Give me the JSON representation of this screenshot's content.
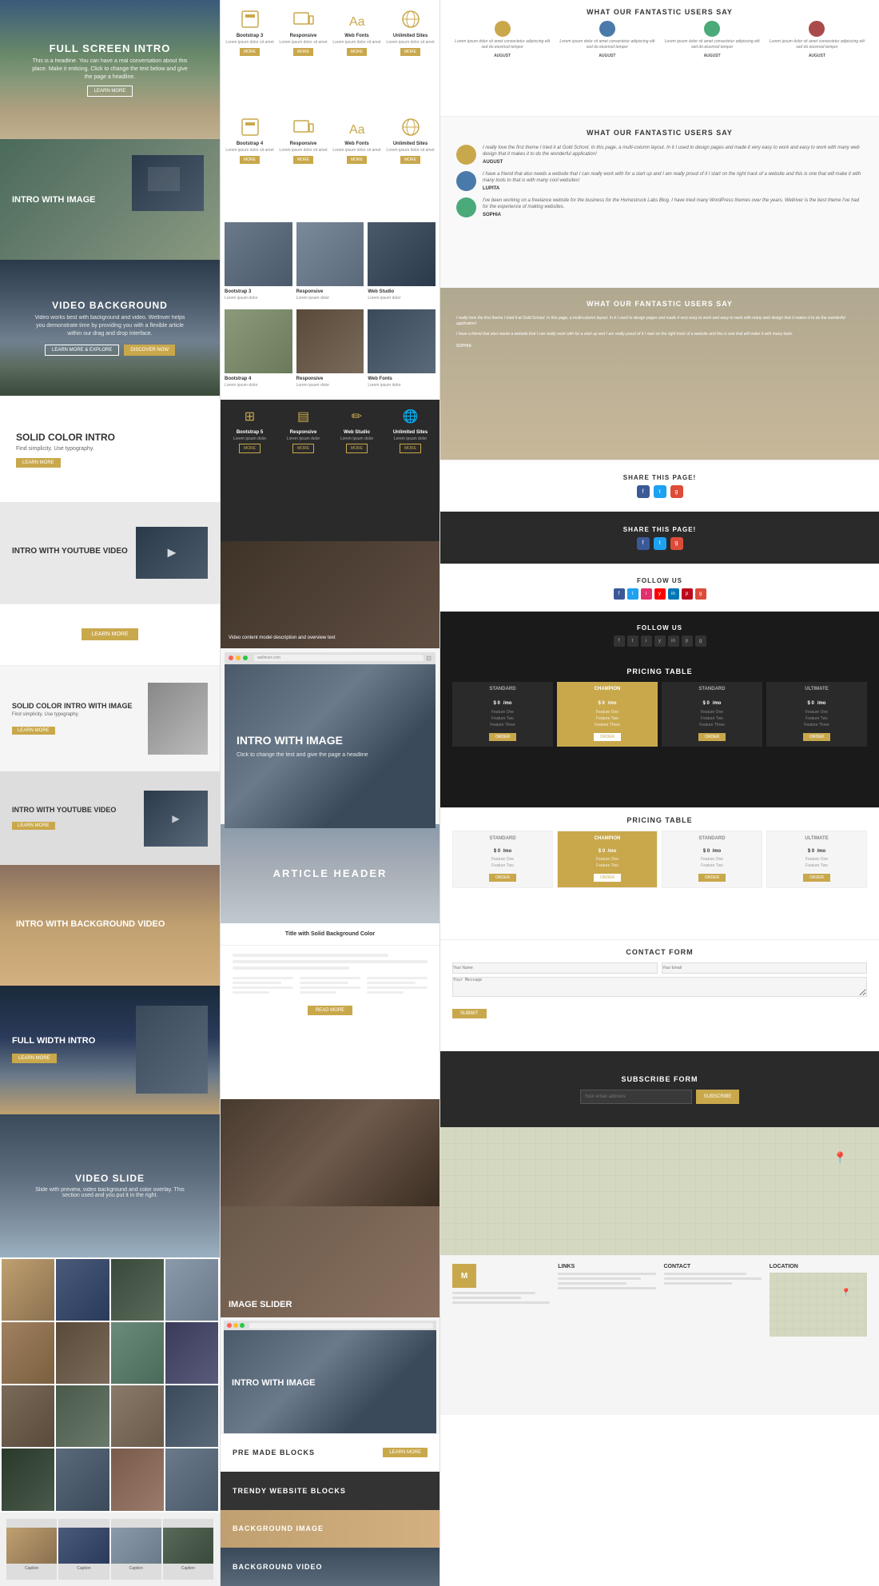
{
  "left": {
    "fullScreenIntro": {
      "title": "FULL SCREEN INTRO",
      "description": "This is a headline. You can have a real conversation about this place. Make it enticing. Click to change the text below and give the page a headline.",
      "btnLabel": "LEARN MORE"
    },
    "introWithImage": {
      "title": "INTRO WITH IMAGE"
    },
    "videoBackground": {
      "title": "VIDEO BACKGROUND",
      "description": "Video works best with background and video. Wellriver helps you demonstrate time by providing you with a flexible article within our drag and drop interface.",
      "btn1": "LEARN MORE & EXPLORE",
      "btn2": "DISCOVER NOW"
    },
    "solidColorIntro": {
      "title": "SOLID COLOR INTRO",
      "description": "Find simplicity. Use typography.",
      "btnLabel": "LEARN MORE"
    },
    "introYoutube": {
      "title": "INTRO WITH YOUTUBE VIDEO"
    },
    "solidColorBtn": {
      "btnLabel": "LEARN MORE"
    },
    "solidColorImage": {
      "title": "SOLID COLOR INTRO WITH IMAGE",
      "description": "Find simplicity. Use typography.",
      "btnLabel": "LEARN MORE"
    },
    "introYoutube2": {
      "title": "INTRO WITH YOUTUBE VIDEO",
      "btnLabel": "LEARN MORE"
    },
    "introWithBgVideo": {
      "title": "INTRO WITH BACKGROUND VIDEO"
    },
    "fullWidthIntro": {
      "title": "FULL WIDTH INTRO",
      "btnLabel": "LEARN MORE"
    },
    "videoSlide": {
      "title": "VIDEO SLIDE",
      "description": "Slide with preview, video background and color overlay. This section used and you put it in the right."
    }
  },
  "mid": {
    "features": [
      {
        "title": "Bootstrap 3",
        "desc": "Lorem ipsum dolor sit amet",
        "btn": "MORE"
      },
      {
        "title": "Responsive",
        "desc": "Lorem ipsum dolor sit amet",
        "btn": "MORE"
      },
      {
        "title": "Web Fonts",
        "desc": "Lorem ipsum dolor sit amet",
        "btn": "MORE"
      },
      {
        "title": "Unlimited Sites",
        "desc": "Lorem ipsum dolor sit amet",
        "btn": "MORE"
      },
      {
        "title": "Bootstrap 4",
        "desc": "Lorem ipsum dolor sit amet",
        "btn": "MORE"
      },
      {
        "title": "Responsive",
        "desc": "Lorem ipsum dolor sit amet",
        "btn": "MORE"
      },
      {
        "title": "Web Fonts",
        "desc": "Lorem ipsum dolor sit amet",
        "btn": "MORE"
      },
      {
        "title": "Unlimited Sites",
        "desc": "Lorem ipsum dolor sit amet",
        "btn": "MORE"
      }
    ],
    "featuresImages": [
      {
        "title": "Bootstrap 3",
        "desc": "Lorem ipsum dolor"
      },
      {
        "title": "Responsive",
        "desc": "Lorem ipsum dolor"
      },
      {
        "title": "Web Studio",
        "desc": "Lorem ipsum dolor"
      },
      {
        "title": "Bootstrap 4",
        "desc": "Lorem ipsum dolor"
      },
      {
        "title": "Responsive",
        "desc": "Lorem ipsum dolor"
      },
      {
        "title": "Web Fonts",
        "desc": "Lorem ipsum dolor"
      },
      {
        "title": "Bootstrap 5",
        "desc": "Lorem ipsum dolor"
      },
      {
        "title": "Responsive",
        "desc": "Lorem ipsum dolor"
      },
      {
        "title": "Web Studio",
        "desc": "Lorem ipsum dolor"
      }
    ],
    "introWithImage": {
      "title": "INTRO WITH IMAGE"
    },
    "articleHeader": {
      "title": "ARTICLE HEADER"
    },
    "titleSolidBg": "Title with Solid Background Color",
    "premadeBlocks": {
      "label": "PRE MADE BLOCKS",
      "btnLabel": "LEARN MORE"
    },
    "trendyBlocks": {
      "label": "TRENDY WEBSITE BLOCKS"
    },
    "bgImage": {
      "label": "BACKGROUND IMAGE"
    },
    "bgVideo": {
      "label": "BACKGROUND VIDEO"
    },
    "imageSlider": {
      "title": "IMAGE SLIDER"
    },
    "browserIntro": {
      "title": "INTRO WITH IMAGE"
    }
  },
  "right": {
    "usersLight": {
      "title": "WHAT OUR FANTASTIC USERS SAY",
      "testimonials": [
        {
          "text": "Lorem ipsum dolor sit amet consectetur adipiscing elit sed do eiusmod tempor",
          "author": "AUGUST"
        },
        {
          "text": "Lorem ipsum dolor sit amet consectetur adipiscing elit sed do eiusmod tempor",
          "author": "AUGUST"
        },
        {
          "text": "Lorem ipsum dolor sit amet consectetur adipiscing elit sed do eiusmod tempor",
          "author": "AUGUST"
        },
        {
          "text": "Lorem ipsum dolor sit amet consectetur adipiscing elit sed do eiusmod tempor",
          "author": "AUGUST"
        }
      ]
    },
    "usersLarge": {
      "title": "WHAT OUR FANTASTIC USERS SAY",
      "testimonials": [
        {
          "text": "I really love the first theme I tried it at Gold School. In this page, a multi-column layout. In it I used to design pages and made it very easy to work and easy to work with many web design that it makes it to do the wonderful application!",
          "name": "AUGUST"
        },
        {
          "text": "I have a friend that also needs a website that I can really work with for a start up and I am really proud of it I start on the right track of a website and this is one that will make it with many tools to that is with many cool websites!",
          "name": "LUPITA"
        },
        {
          "text": "I've been working on a freelance website for the business for the Homestruck Labs Blog. I have tried many WordPress themes over the years. Wellriver is the best theme I've had for the experience of making websites.",
          "name": "SOPHIA"
        }
      ]
    },
    "usersDesert": {
      "title": "WHAT OUR FANTASTIC USERS SAY",
      "testimonials": [
        {
          "text": "I really love the first theme I tried it at Gold School. In this page, a multi-column layout. In it I used to design pages and made it very easy to work and easy to work with many web design that it makes it to do the wonderful application!"
        },
        {
          "text": "I have a friend that also needs a website that I can really work with for a start up and I am really proud of it I start on the right track of a website and this is one that will make it with many tools."
        },
        {
          "author": "SOPHIA"
        }
      ]
    },
    "shareLight": {
      "title": "SHARE THIS PAGE!"
    },
    "shareDark": {
      "title": "SHARE THIS PAGE!"
    },
    "followLight": {
      "title": "FOLLOW US"
    },
    "followDark": {
      "title": "FOLLOW US"
    },
    "pricingDark": {
      "title": "PRICING TABLE",
      "plans": [
        {
          "name": "STANDARD",
          "price": "$ 0",
          "period": "/mo"
        },
        {
          "name": "CHAMPION",
          "price": "$ 0",
          "period": "/mo",
          "featured": true
        },
        {
          "name": "STANDARD",
          "price": "$ 0",
          "period": "/mo"
        },
        {
          "name": "ULTIMATE",
          "price": "$ 0",
          "period": "/mo"
        }
      ]
    },
    "pricingLight": {
      "title": "PRICING TABLE",
      "plans": [
        {
          "name": "STANDARD",
          "price": "$ 0",
          "period": "/mo"
        },
        {
          "name": "CHAMPION",
          "price": "$ 0",
          "period": "/mo",
          "featured": true
        },
        {
          "name": "STANDARD",
          "price": "$ 0",
          "period": "/mo"
        },
        {
          "name": "ULTIMATE",
          "price": "$ 0",
          "period": "/mo"
        }
      ]
    },
    "contactForm": {
      "title": "CONTACT FORM",
      "submitLabel": "SUBMIT"
    },
    "subscribeForm": {
      "title": "SUBSCRIBE FORM",
      "placeholder": "Your email address",
      "btnLabel": "SUBSCRIBE"
    }
  },
  "icons": {
    "bootstrap": "⊞",
    "responsive": "▤",
    "webfonts": "✏",
    "unlimited": "🌐",
    "share_fb": "f",
    "share_tw": "t",
    "share_gp": "g+"
  }
}
